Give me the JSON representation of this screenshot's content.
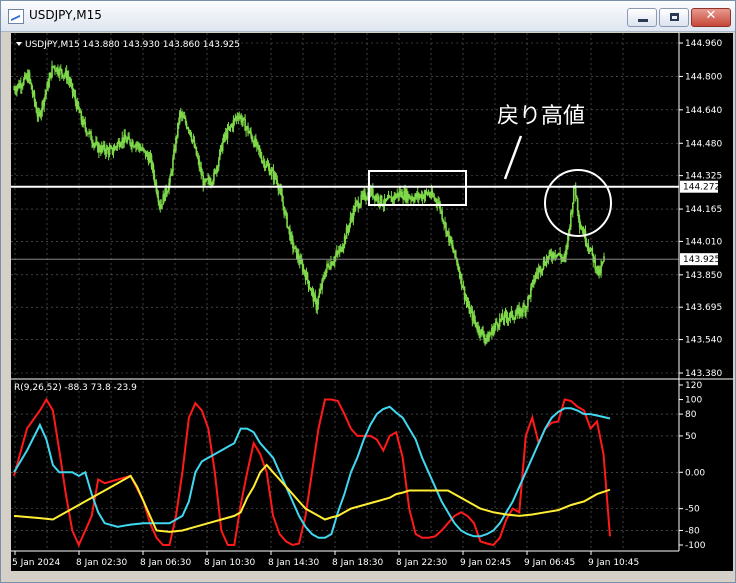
{
  "window": {
    "title": "USDJPY,M15",
    "controls": [
      "minimize",
      "maximize",
      "close"
    ]
  },
  "chart": {
    "info": "USDJPY,M15 143.880 143.930 143.860 143.925",
    "price_axis": [
      "144.960",
      "144.800",
      "144.640",
      "144.480",
      "144.325",
      "144.165",
      "144.010",
      "143.850",
      "143.695",
      "143.540",
      "143.380"
    ],
    "price_range": [
      143.38,
      144.96
    ],
    "horizontal_line_label": "144.272",
    "current_price_label": "143.925",
    "annotation": "戻り高値",
    "indicator_label": "R(9,26,52) -88.3 73.8 -23.9",
    "indicator_axis": [
      "120",
      "100",
      "80",
      "50",
      "0.00",
      "-50",
      "-80",
      "-100"
    ],
    "indicator_range": [
      -100,
      120
    ],
    "time_axis": [
      "5 Jan 2024",
      "8 Jan 02:30",
      "8 Jan 06:30",
      "8 Jan 10:30",
      "8 Jan 14:30",
      "8 Jan 18:30",
      "8 Jan 22:30",
      "9 Jan 02:45",
      "9 Jan 06:45",
      "9 Jan 10:45"
    ],
    "colors": {
      "background": "#000000",
      "candles": "#7fd94a",
      "grid": "#6a6a6a",
      "lines": "#ffffff",
      "rci_short": "#ff1a1a",
      "rci_mid": "#40d8f0",
      "rci_long": "#ffee33"
    }
  },
  "chart_data": {
    "type": "line",
    "title": "USDJPY,M15",
    "price_anchors": [
      [
        0,
        144.74
      ],
      [
        3,
        144.8
      ],
      [
        5,
        144.6
      ],
      [
        8,
        144.85
      ],
      [
        11,
        144.8
      ],
      [
        14,
        144.58
      ],
      [
        17,
        144.46
      ],
      [
        20,
        144.44
      ],
      [
        22,
        144.5
      ],
      [
        25,
        144.48
      ],
      [
        28,
        144.4
      ],
      [
        30,
        144.18
      ],
      [
        32,
        144.3
      ],
      [
        34,
        144.62
      ],
      [
        36,
        144.55
      ],
      [
        39,
        144.28
      ],
      [
        41,
        144.32
      ],
      [
        43,
        144.5
      ],
      [
        46,
        144.62
      ],
      [
        49,
        144.5
      ],
      [
        51,
        144.4
      ],
      [
        54,
        144.3
      ],
      [
        57,
        144.0
      ],
      [
        60,
        143.84
      ],
      [
        62,
        143.7
      ],
      [
        64,
        143.88
      ],
      [
        67,
        143.97
      ],
      [
        70,
        144.18
      ],
      [
        73,
        144.25
      ],
      [
        76,
        144.19
      ],
      [
        79,
        144.24
      ],
      [
        82,
        144.22
      ],
      [
        85,
        144.24
      ],
      [
        87,
        144.2
      ],
      [
        89,
        144.04
      ],
      [
        91,
        143.9
      ],
      [
        93,
        143.7
      ],
      [
        95,
        143.6
      ],
      [
        97,
        143.54
      ],
      [
        99,
        143.62
      ],
      [
        101,
        143.65
      ],
      [
        103,
        143.66
      ],
      [
        105,
        143.7
      ],
      [
        107,
        143.85
      ],
      [
        109,
        143.92
      ],
      [
        111,
        143.96
      ],
      [
        113,
        143.92
      ],
      [
        114,
        144.1
      ],
      [
        115,
        144.28
      ],
      [
        116,
        144.1
      ],
      [
        118,
        143.98
      ],
      [
        120,
        143.85
      ],
      [
        121,
        143.925
      ]
    ],
    "horizontal_line": 144.272,
    "rci_series": [
      {
        "name": "RCI 9",
        "values": [
          [
            0,
            -5
          ],
          [
            2,
            60
          ],
          [
            4,
            85
          ],
          [
            5,
            100
          ],
          [
            6,
            85
          ],
          [
            7,
            30
          ],
          [
            8,
            -30
          ],
          [
            9,
            -80
          ],
          [
            10,
            -100
          ],
          [
            11,
            -80
          ],
          [
            12,
            -60
          ],
          [
            13,
            -10
          ],
          [
            14,
            -15
          ],
          [
            16,
            -10
          ],
          [
            18,
            -5
          ],
          [
            20,
            -40
          ],
          [
            21,
            -70
          ],
          [
            22,
            -90
          ],
          [
            23,
            -100
          ],
          [
            24,
            -100
          ],
          [
            25,
            -60
          ],
          [
            26,
            0
          ],
          [
            27,
            75
          ],
          [
            28,
            95
          ],
          [
            29,
            85
          ],
          [
            30,
            60
          ],
          [
            31,
            0
          ],
          [
            32,
            -80
          ],
          [
            33,
            -100
          ],
          [
            34,
            -100
          ],
          [
            35,
            -45
          ],
          [
            36,
            0
          ],
          [
            37,
            40
          ],
          [
            38,
            25
          ],
          [
            39,
            0
          ],
          [
            40,
            -60
          ],
          [
            41,
            -85
          ],
          [
            42,
            -95
          ],
          [
            43,
            -100
          ],
          [
            44,
            -98
          ],
          [
            45,
            -60
          ],
          [
            46,
            0
          ],
          [
            47,
            60
          ],
          [
            48,
            100
          ],
          [
            49,
            100
          ],
          [
            50,
            98
          ],
          [
            51,
            80
          ],
          [
            52,
            60
          ],
          [
            53,
            50
          ],
          [
            54,
            50
          ],
          [
            55,
            50
          ],
          [
            56,
            45
          ],
          [
            57,
            30
          ],
          [
            58,
            50
          ],
          [
            59,
            55
          ],
          [
            60,
            20
          ],
          [
            61,
            -50
          ],
          [
            62,
            -85
          ],
          [
            63,
            -90
          ],
          [
            64,
            -90
          ],
          [
            65,
            -88
          ],
          [
            66,
            -80
          ],
          [
            67,
            -70
          ],
          [
            68,
            -60
          ],
          [
            69,
            -55
          ],
          [
            70,
            -60
          ],
          [
            71,
            -70
          ],
          [
            72,
            -95
          ],
          [
            73,
            -98
          ],
          [
            74,
            -100
          ],
          [
            75,
            -90
          ],
          [
            76,
            -65
          ],
          [
            77,
            -50
          ],
          [
            78,
            -55
          ],
          [
            79,
            50
          ],
          [
            80,
            75
          ],
          [
            81,
            40
          ],
          [
            82,
            60
          ],
          [
            83,
            68
          ],
          [
            84,
            70
          ],
          [
            85,
            100
          ],
          [
            86,
            98
          ],
          [
            87,
            90
          ],
          [
            88,
            85
          ],
          [
            89,
            60
          ],
          [
            90,
            70
          ],
          [
            91,
            25
          ],
          [
            92,
            -88
          ]
        ]
      },
      {
        "name": "RCI 26",
        "values": [
          [
            0,
            0
          ],
          [
            2,
            30
          ],
          [
            4,
            65
          ],
          [
            5,
            45
          ],
          [
            6,
            10
          ],
          [
            7,
            0
          ],
          [
            8,
            0
          ],
          [
            9,
            0
          ],
          [
            10,
            -5
          ],
          [
            11,
            0
          ],
          [
            12,
            -30
          ],
          [
            13,
            -55
          ],
          [
            14,
            -70
          ],
          [
            16,
            -75
          ],
          [
            18,
            -72
          ],
          [
            20,
            -70
          ],
          [
            22,
            -70
          ],
          [
            24,
            -70
          ],
          [
            26,
            -60
          ],
          [
            27,
            -40
          ],
          [
            28,
            0
          ],
          [
            29,
            15
          ],
          [
            30,
            20
          ],
          [
            31,
            25
          ],
          [
            32,
            30
          ],
          [
            33,
            35
          ],
          [
            34,
            40
          ],
          [
            35,
            60
          ],
          [
            36,
            60
          ],
          [
            37,
            55
          ],
          [
            38,
            40
          ],
          [
            40,
            20
          ],
          [
            41,
            0
          ],
          [
            42,
            -20
          ],
          [
            43,
            -40
          ],
          [
            44,
            -60
          ],
          [
            45,
            -75
          ],
          [
            46,
            -85
          ],
          [
            47,
            -90
          ],
          [
            48,
            -90
          ],
          [
            49,
            -85
          ],
          [
            50,
            -55
          ],
          [
            51,
            -30
          ],
          [
            52,
            0
          ],
          [
            53,
            20
          ],
          [
            54,
            45
          ],
          [
            55,
            65
          ],
          [
            56,
            80
          ],
          [
            57,
            87
          ],
          [
            58,
            90
          ],
          [
            59,
            82
          ],
          [
            60,
            75
          ],
          [
            61,
            60
          ],
          [
            62,
            45
          ],
          [
            63,
            20
          ],
          [
            64,
            0
          ],
          [
            65,
            -20
          ],
          [
            66,
            -40
          ],
          [
            67,
            -55
          ],
          [
            68,
            -70
          ],
          [
            69,
            -80
          ],
          [
            70,
            -85
          ],
          [
            71,
            -88
          ],
          [
            72,
            -88
          ],
          [
            73,
            -85
          ],
          [
            74,
            -80
          ],
          [
            75,
            -70
          ],
          [
            76,
            -55
          ],
          [
            77,
            -40
          ],
          [
            78,
            -20
          ],
          [
            79,
            0
          ],
          [
            80,
            20
          ],
          [
            81,
            40
          ],
          [
            82,
            60
          ],
          [
            83,
            75
          ],
          [
            84,
            83
          ],
          [
            85,
            88
          ],
          [
            86,
            88
          ],
          [
            87,
            85
          ],
          [
            88,
            80
          ],
          [
            89,
            80
          ],
          [
            90,
            78
          ],
          [
            91,
            76
          ],
          [
            92,
            74
          ]
        ]
      },
      {
        "name": "RCI 52",
        "values": [
          [
            0,
            -60
          ],
          [
            4,
            -63
          ],
          [
            6,
            -65
          ],
          [
            8,
            -55
          ],
          [
            10,
            -45
          ],
          [
            12,
            -35
          ],
          [
            14,
            -25
          ],
          [
            16,
            -15
          ],
          [
            18,
            -5
          ],
          [
            19,
            -20
          ],
          [
            20,
            -40
          ],
          [
            21,
            -60
          ],
          [
            22,
            -80
          ],
          [
            24,
            -82
          ],
          [
            26,
            -80
          ],
          [
            28,
            -75
          ],
          [
            30,
            -70
          ],
          [
            32,
            -65
          ],
          [
            34,
            -60
          ],
          [
            35,
            -55
          ],
          [
            36,
            -35
          ],
          [
            37,
            -20
          ],
          [
            38,
            0
          ],
          [
            39,
            10
          ],
          [
            40,
            0
          ],
          [
            41,
            -10
          ],
          [
            42,
            -20
          ],
          [
            43,
            -30
          ],
          [
            44,
            -40
          ],
          [
            45,
            -50
          ],
          [
            46,
            -55
          ],
          [
            47,
            -60
          ],
          [
            48,
            -65
          ],
          [
            49,
            -62
          ],
          [
            50,
            -60
          ],
          [
            51,
            -55
          ],
          [
            52,
            -50
          ],
          [
            54,
            -45
          ],
          [
            56,
            -40
          ],
          [
            58,
            -35
          ],
          [
            59,
            -30
          ],
          [
            60,
            -28
          ],
          [
            61,
            -25
          ],
          [
            63,
            -25
          ],
          [
            65,
            -25
          ],
          [
            67,
            -25
          ],
          [
            68,
            -30
          ],
          [
            70,
            -40
          ],
          [
            72,
            -50
          ],
          [
            74,
            -55
          ],
          [
            76,
            -58
          ],
          [
            78,
            -60
          ],
          [
            80,
            -58
          ],
          [
            82,
            -55
          ],
          [
            84,
            -52
          ],
          [
            86,
            -45
          ],
          [
            88,
            -40
          ],
          [
            90,
            -30
          ],
          [
            92,
            -24
          ]
        ]
      }
    ],
    "x_count": 93
  }
}
